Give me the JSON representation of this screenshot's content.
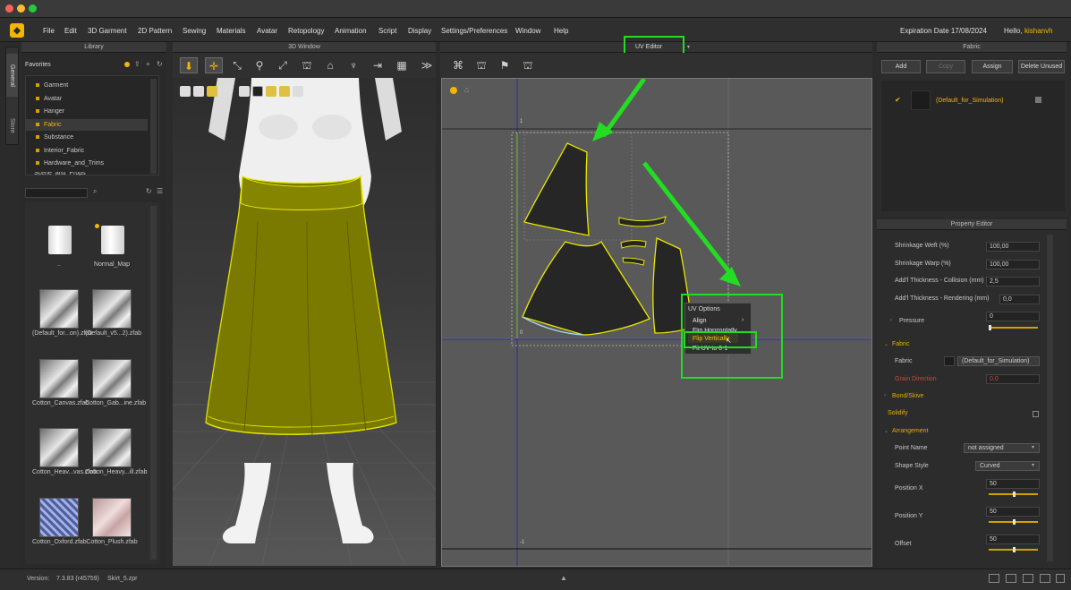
{
  "menu": [
    "File",
    "Edit",
    "3D Garment",
    "2D Pattern",
    "Sewing",
    "Materials",
    "Avatar",
    "Retopology",
    "Animation",
    "Script",
    "Display",
    "Settings/Preferences",
    "Window",
    "Help"
  ],
  "header": {
    "expiration": "Expiration Date 17/08/2024",
    "hello": "Hello,",
    "username": "kishanvh"
  },
  "side_tabs": [
    "General",
    "Store"
  ],
  "library": {
    "title": "Library",
    "favorites_label": "Favorites",
    "items": [
      "Garment",
      "Avatar",
      "Hanger",
      "Fabric",
      "Substance",
      "Interior_Fabric",
      "Hardware_and_Trims",
      "Scene_and_Props"
    ],
    "files": [
      {
        "name": ".."
      },
      {
        "name": "Normal_Map"
      },
      {
        "name": "(Default_for...on).zfab"
      },
      {
        "name": "(Default_v5...2).zfab"
      },
      {
        "name": "Cotton_Canvas.zfab"
      },
      {
        "name": "Cotton_Gab...ine.zfab"
      },
      {
        "name": "Cotton_Heav...vas.zfab"
      },
      {
        "name": "Cotton_Heavy...ill.zfab"
      },
      {
        "name": "Cotton_Oxford.zfab"
      },
      {
        "name": "Cotton_Plush.zfab"
      }
    ]
  },
  "window3d": {
    "title": "3D Window"
  },
  "uv_editor": {
    "title": "UV Editor",
    "context_menu": {
      "title": "UV Options",
      "items": [
        "Align",
        "Flip Horizontally",
        "Flip Vertically",
        "Fit UV to 0-1"
      ]
    },
    "axis_labels": [
      "1",
      "0",
      "-1"
    ]
  },
  "fabric_panel": {
    "title": "Fabric",
    "buttons": [
      "Add",
      "Copy",
      "Assign",
      "Delete Unused"
    ],
    "fabric_name": "(Default_for_Simulation)"
  },
  "property_editor": {
    "title": "Property Editor",
    "rows": [
      {
        "label": "Shrinkage Weft (%)",
        "value": "100,00"
      },
      {
        "label": "Shrinkage Warp (%)",
        "value": "100,00"
      },
      {
        "label": "Add'l Thickness - Collision (mm)",
        "value": "2,5"
      },
      {
        "label": "Add'l Thickness - Rendering (mm)",
        "value": "0,0"
      }
    ],
    "pressure": {
      "label": "Pressure",
      "value": "0"
    },
    "fabric_section": "Fabric",
    "fabric_label": "Fabric",
    "fabric_value": "(Default_for_Simulation)",
    "grain_label": "Grain Direction",
    "grain_value": "0,0",
    "bond_section": "Bond/Skive",
    "solidify": "Solidify",
    "arrangement_section": "Arrangement",
    "point_name_label": "Point Name",
    "point_name_value": "not assigned",
    "shape_style_label": "Shape Style",
    "shape_style_value": "Curved",
    "position_x_label": "Position X",
    "position_x_value": "50",
    "position_y_label": "Position Y",
    "position_y_value": "50",
    "offset_label": "Offset",
    "offset_value": "50"
  },
  "status": {
    "version_label": "Version:",
    "version": "7.3.83 (r45759)",
    "file": "Skirt_5.zpr"
  },
  "colors": {
    "accent": "#f2b705",
    "highlight_green": "#22dd22",
    "skirt": "#7a7a00"
  }
}
